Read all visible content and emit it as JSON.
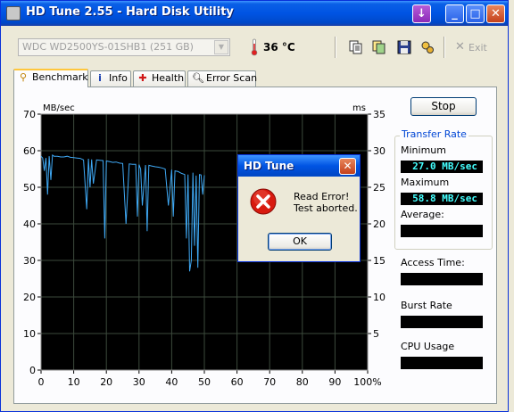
{
  "window": {
    "title": "HD Tune 2.55 - Hard Disk Utility",
    "buttons": {
      "menu": "↓",
      "minimize": "_",
      "maximize": "□",
      "close": "✕"
    }
  },
  "toolbar": {
    "drive": "WDC WD2500YS-01SHB1 (251 GB)",
    "temperature": "36 °C",
    "exit_label": "Exit",
    "icons": [
      "copy-icon",
      "copy-all-icon",
      "save-icon",
      "options-icon",
      "exit-icon"
    ]
  },
  "tabs": [
    {
      "label": "Benchmark",
      "icon": "benchmark-icon",
      "active": true
    },
    {
      "label": "Info",
      "icon": "info-icon",
      "active": false
    },
    {
      "label": "Health",
      "icon": "health-icon",
      "active": false
    },
    {
      "label": "Error Scan",
      "icon": "search-icon",
      "active": false
    }
  ],
  "benchmark": {
    "stop_label": "Stop",
    "transfer_rate_label": "Transfer Rate",
    "minimum_label": "Minimum",
    "minimum_value": "27.0 MB/sec",
    "maximum_label": "Maximum",
    "maximum_value": "58.8 MB/sec",
    "average_label": "Average:",
    "average_value": "",
    "access_time_label": "Access Time:",
    "access_time_value": "",
    "burst_rate_label": "Burst Rate",
    "burst_rate_value": "",
    "cpu_usage_label": "CPU Usage",
    "cpu_usage_value": ""
  },
  "dialog": {
    "title": "HD Tune",
    "message_line1": "Read Error!",
    "message_line2": "Test aborted.",
    "ok_label": "OK",
    "icon": "error-icon"
  },
  "chart_data": {
    "type": "line",
    "ylabel": "MB/sec",
    "y2label": "ms",
    "ylim": [
      0,
      70
    ],
    "y2lim": [
      0,
      35
    ],
    "xlim": [
      0,
      100
    ],
    "y_ticks": [
      0,
      10,
      20,
      30,
      40,
      50,
      60,
      70
    ],
    "y2_ticks": [
      5,
      10,
      15,
      20,
      25,
      30,
      35
    ],
    "x_ticks": [
      "0",
      "10",
      "20",
      "30",
      "40",
      "50",
      "60",
      "70",
      "80",
      "90",
      "100%"
    ],
    "grid": true,
    "colors": {
      "background": "#000000",
      "grid": "#3c4a3c",
      "line": "#3fa9f5"
    },
    "series": [
      {
        "x": [
          0,
          0.5,
          1,
          1.5,
          2,
          2.5,
          3,
          3.5,
          4,
          5,
          6,
          7,
          8,
          9,
          10,
          11,
          12,
          13,
          14,
          14.5,
          15,
          15.5,
          16,
          17,
          18,
          19,
          19.5,
          20,
          20.5,
          21,
          22,
          23,
          24,
          25,
          26,
          27,
          28,
          29,
          29.5,
          30,
          30.5,
          31,
          32,
          32.5,
          33,
          34,
          35,
          36,
          37,
          38,
          39,
          40,
          40.5,
          41,
          42,
          43,
          44,
          44.5,
          45,
          45.5,
          46,
          46.5,
          47,
          47.5,
          48,
          48.5,
          49,
          49.5,
          50
        ],
        "y": [
          58.5,
          58,
          54.5,
          58,
          48,
          58.5,
          52,
          58.8,
          58.5,
          58.5,
          58.3,
          58.3,
          58.5,
          58.2,
          58.1,
          58,
          57.9,
          57.5,
          44,
          57.8,
          50,
          57.6,
          51,
          57.5,
          57.4,
          57.3,
          36,
          57.2,
          57.1,
          57,
          56.8,
          56.9,
          56.6,
          56.5,
          40,
          56.4,
          56.3,
          56.3,
          42,
          56.2,
          55,
          45,
          56.1,
          38,
          56,
          55.8,
          55.6,
          55.5,
          55.3,
          55,
          45,
          54.8,
          42,
          54.5,
          54.3,
          53.8,
          53.5,
          36,
          53.5,
          27,
          30,
          54,
          34,
          53.2,
          28,
          53.5,
          53.4,
          48,
          53.3
        ]
      }
    ]
  }
}
